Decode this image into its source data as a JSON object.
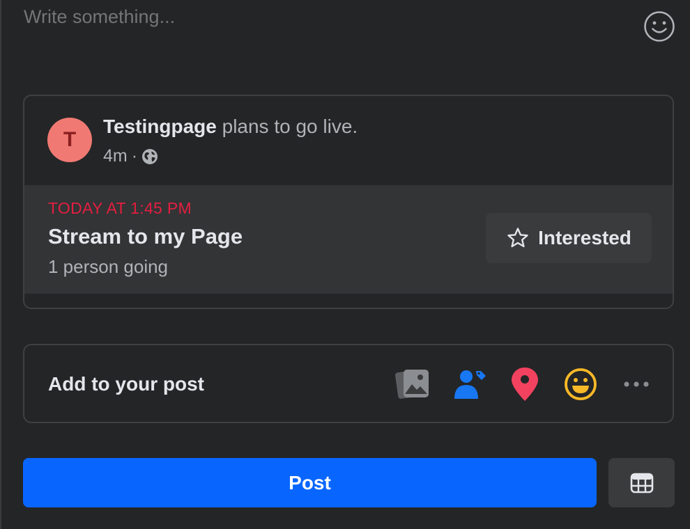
{
  "composer": {
    "placeholder": "Write something...",
    "emoji_icon": "smiley-icon"
  },
  "post_preview": {
    "avatar_letter": "T",
    "author_name": "Testingpage",
    "action_text": " plans to go live.",
    "time": "4m",
    "separator": "·",
    "privacy_icon": "globe-icon",
    "event": {
      "date": "TODAY AT 1:45 PM",
      "title": "Stream to my Page",
      "going": "1 person going",
      "interested_label": "Interested",
      "interested_icon": "star-icon"
    }
  },
  "add_to_post": {
    "label": "Add to your post",
    "icons": [
      "photo-video-icon",
      "tag-people-icon",
      "location-pin-icon",
      "feeling-emoji-icon",
      "more-options-icon"
    ]
  },
  "actions": {
    "post_label": "Post",
    "schedule_icon": "calendar-icon"
  },
  "colors": {
    "background": "#242526",
    "primary_blue": "#0866ff",
    "event_date_red": "#e41e3f",
    "avatar_bg": "#f07a73",
    "tag_blue": "#1877f2",
    "pin_red": "#f3425f",
    "emoji_yellow": "#f7b928"
  }
}
